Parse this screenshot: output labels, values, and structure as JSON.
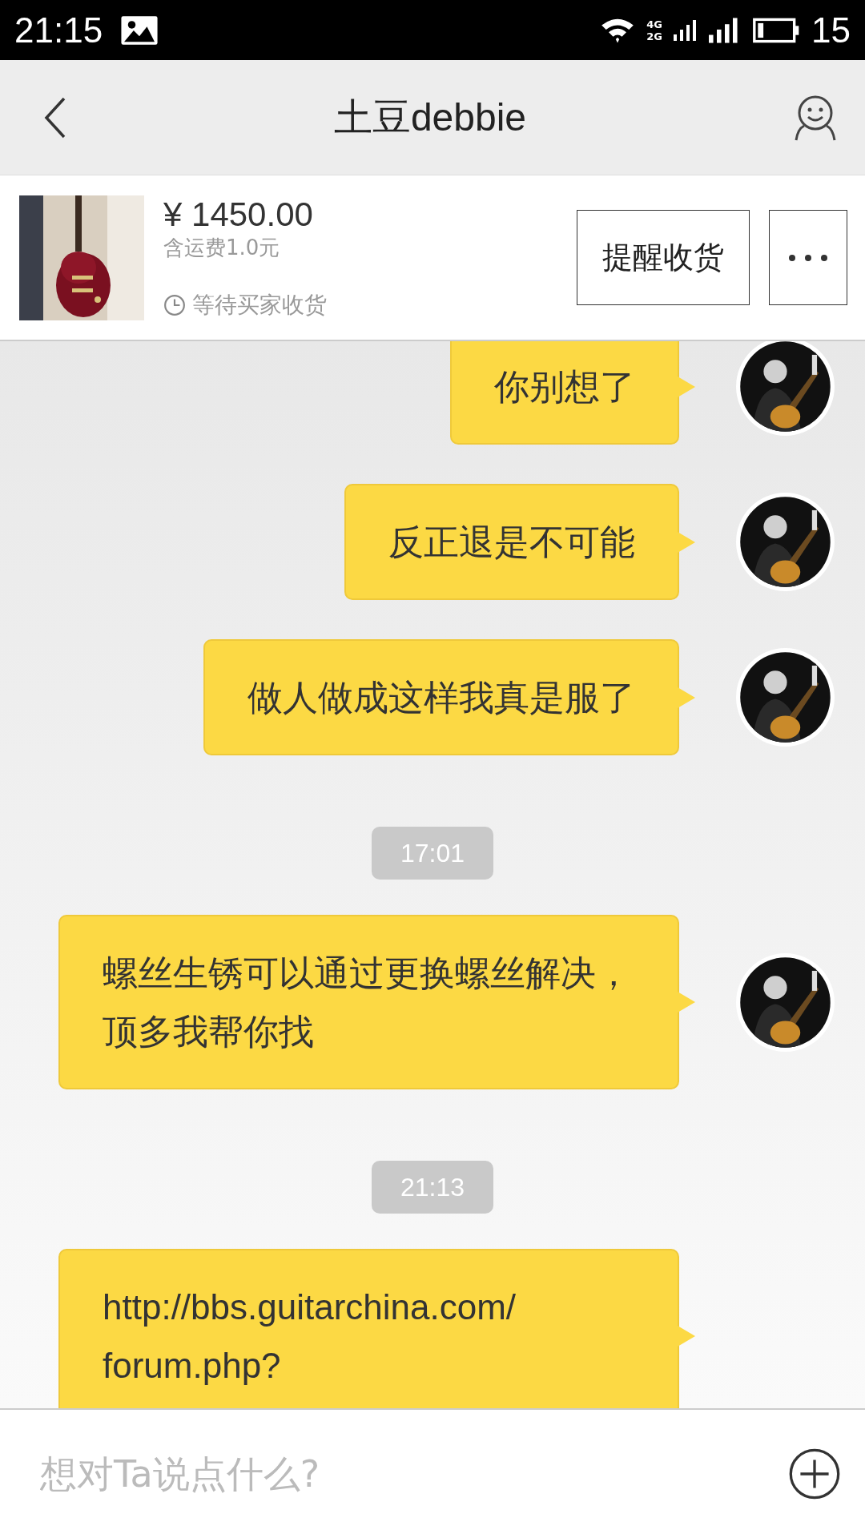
{
  "status_bar": {
    "time": "21:15",
    "network_top": "4G",
    "network_bottom": "2G",
    "battery": "15"
  },
  "header": {
    "title": "土豆debbie"
  },
  "order": {
    "price": "¥ 1450.00",
    "shipping": "含运费1.0元",
    "status": "等待买家收货",
    "action": "提醒收货"
  },
  "messages": [
    {
      "kind": "message",
      "text": "你别想了",
      "avatar": true
    },
    {
      "kind": "message",
      "text": "反正退是不可能",
      "avatar": true
    },
    {
      "kind": "message",
      "text": "做人做成这样我真是服了",
      "avatar": true
    },
    {
      "kind": "time",
      "text": "17:01"
    },
    {
      "kind": "message",
      "text": "螺丝生锈可以通过更换螺丝解决，顶多我帮你找",
      "avatar": true
    },
    {
      "kind": "time",
      "text": "21:13"
    },
    {
      "kind": "message",
      "text": "http://bbs.guitarchina.com/forum.php?",
      "avatar": false
    }
  ],
  "composer": {
    "placeholder": "想对Ta说点什么?"
  }
}
